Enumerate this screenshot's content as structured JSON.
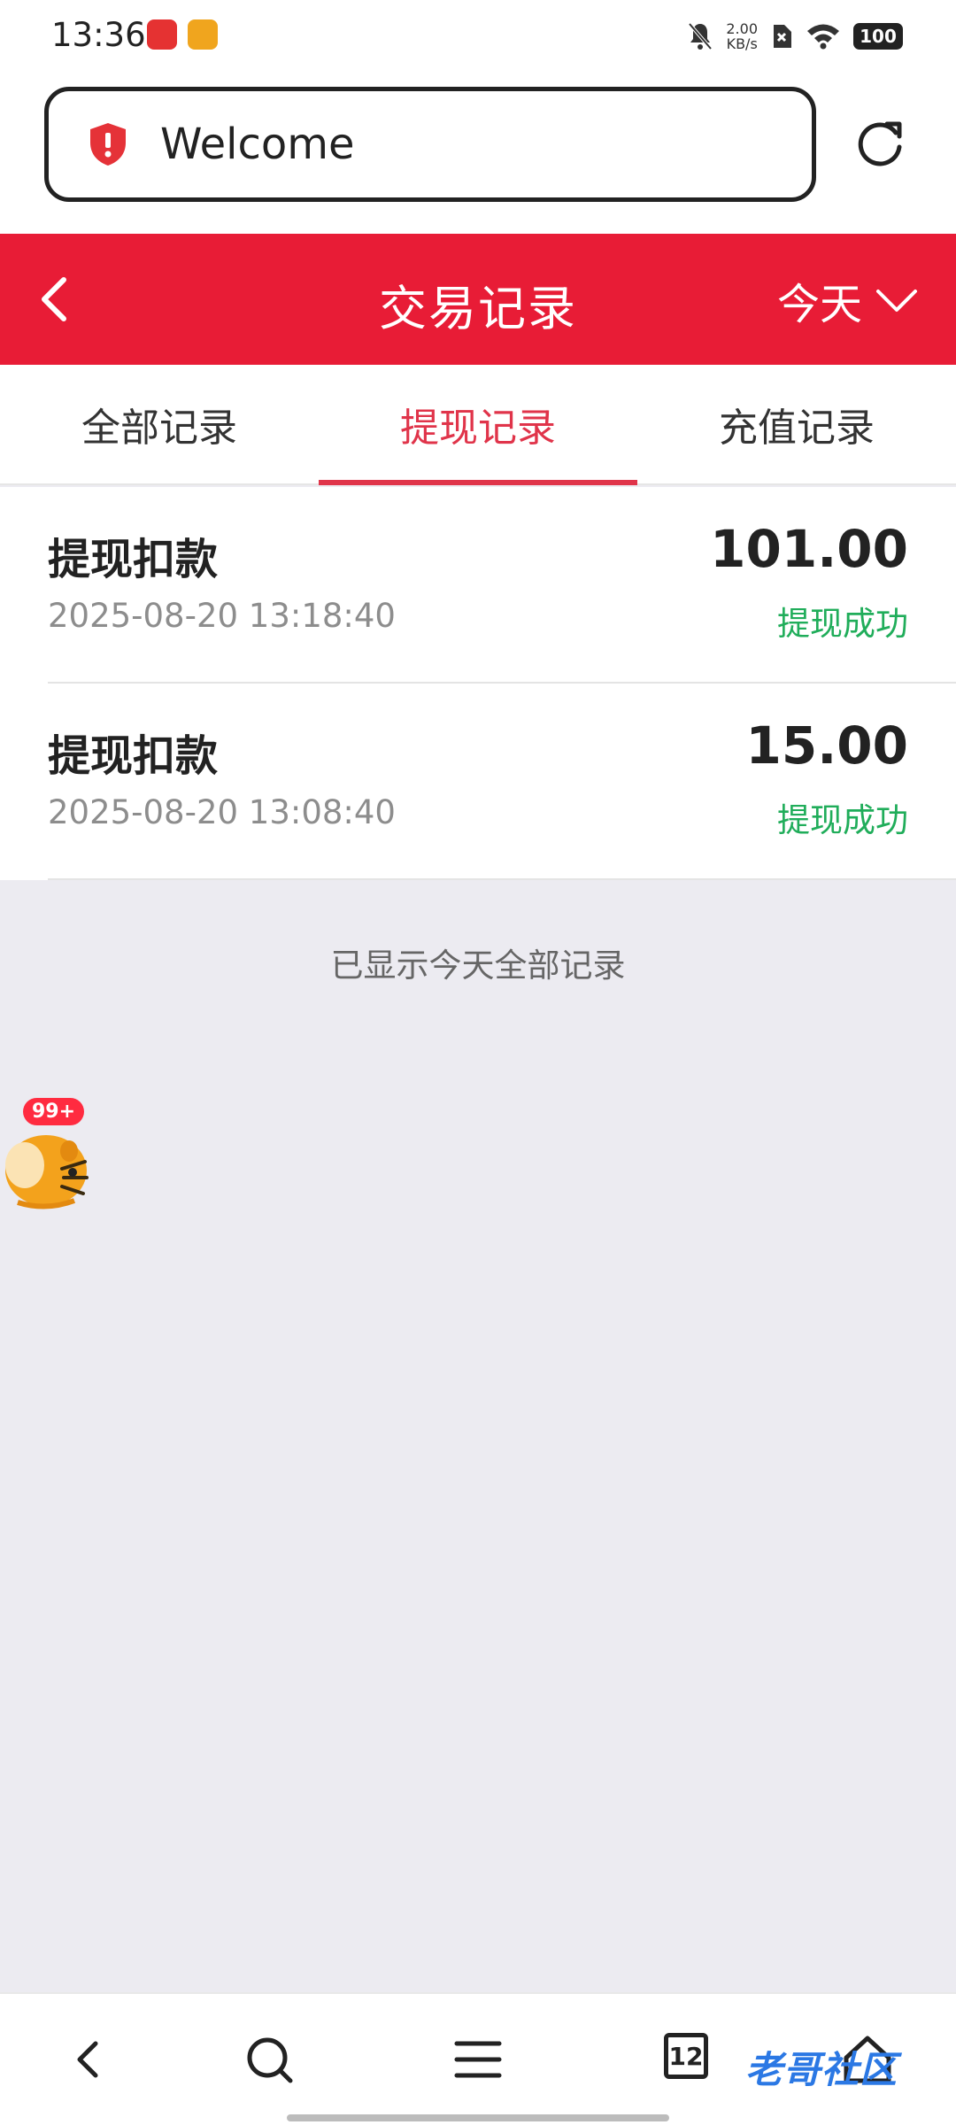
{
  "status_bar": {
    "time": "13:36",
    "net_speed_value": "2.00",
    "net_speed_unit": "KB/s",
    "battery": "100"
  },
  "browser": {
    "url_text": "Welcome"
  },
  "header": {
    "title": "交易记录",
    "date_filter": "今天",
    "color": "#e81c36"
  },
  "tabs": [
    {
      "label": "全部记录",
      "active": false
    },
    {
      "label": "提现记录",
      "active": true
    },
    {
      "label": "充值记录",
      "active": false
    }
  ],
  "records": [
    {
      "title": "提现扣款",
      "time": "2025-08-20 13:18:40",
      "amount": "101.00",
      "status": "提现成功"
    },
    {
      "title": "提现扣款",
      "time": "2025-08-20 13:08:40",
      "amount": "15.00",
      "status": "提现成功"
    }
  ],
  "footer_note": "已显示今天全部记录",
  "mascot": {
    "badge": "99+"
  },
  "bottom_nav": {
    "tab_count": "12",
    "watermark": "老哥社区"
  },
  "colors": {
    "accent": "#e0344a",
    "success": "#20ad5a",
    "background": "#ecebf1"
  }
}
